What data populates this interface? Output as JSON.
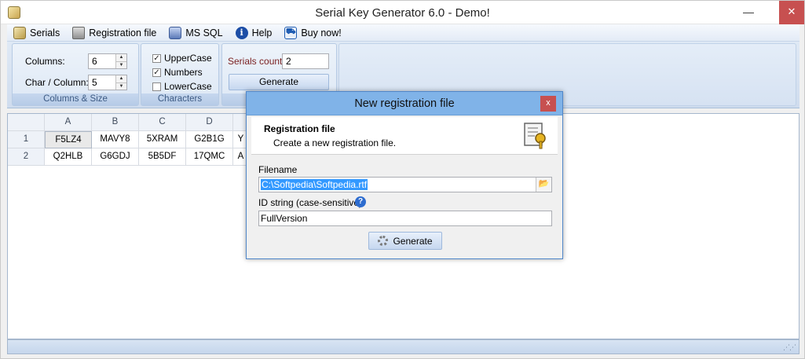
{
  "window": {
    "title": "Serial Key Generator 6.0 - Demo!",
    "minimize": "—",
    "close": "✕"
  },
  "menu": [
    {
      "label": "Serials",
      "icon": "serials-icon"
    },
    {
      "label": "Registration file",
      "icon": "lock-icon"
    },
    {
      "label": "MS SQL",
      "icon": "database-icon"
    },
    {
      "label": "Help",
      "icon": "info-icon"
    },
    {
      "label": "Buy now!",
      "icon": "cart-icon"
    }
  ],
  "ribbon": {
    "columns_label": "Columns:",
    "columns_value": "6",
    "char_label": "Char / Column:",
    "char_value": "5",
    "group1_caption": "Columns & Size",
    "uppercase_label": "UpperCase",
    "numbers_label": "Numbers",
    "lowercase_label": "LowerCase",
    "group2_caption": "Characters",
    "serials_count_label": "Serials count:",
    "serials_count_value": "2",
    "generate_label": "Generate"
  },
  "grid": {
    "headers": [
      "A",
      "B",
      "C",
      "D"
    ],
    "rows": [
      {
        "num": "1",
        "cells": [
          "F5LZ4",
          "MAVY8",
          "5XRAM",
          "G2B1G"
        ],
        "tail": "Y"
      },
      {
        "num": "2",
        "cells": [
          "Q2HLB",
          "G6GDJ",
          "5B5DF",
          "17QMC"
        ],
        "tail": "A"
      }
    ]
  },
  "dialog": {
    "title": "New registration file",
    "close": "x",
    "header_title": "Registration file",
    "header_desc": "Create a new registration file.",
    "filename_label": "Filename",
    "filename_value": "C:\\Softpedia\\Softpedia.rtf",
    "id_label": "ID string (case-sensitive)",
    "id_value": "FullVersion",
    "generate_label": "Generate"
  },
  "colors": {
    "accent": "#80b3e8",
    "ribbon": "#dfe9f5",
    "close": "#c75050"
  }
}
